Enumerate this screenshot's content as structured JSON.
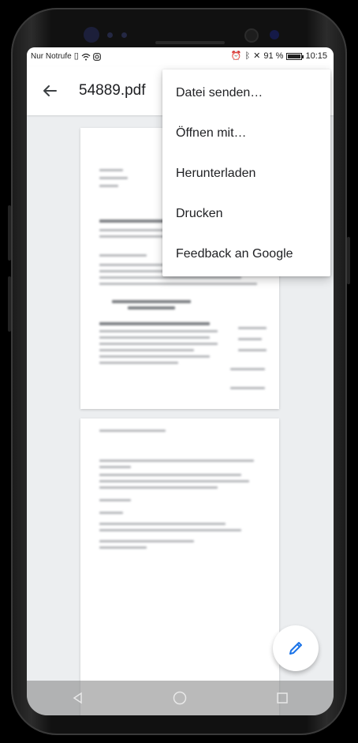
{
  "status_bar": {
    "carrier": "Nur Notrufe",
    "battery_percent": "91 %",
    "time": "10:15",
    "battery_level": 0.91
  },
  "app_bar": {
    "back_icon": "arrow-back-icon",
    "title": "54889.pdf"
  },
  "overflow_menu": {
    "items": [
      {
        "label": "Datei senden…"
      },
      {
        "label": "Öffnen mit…"
      },
      {
        "label": "Herunterladen"
      },
      {
        "label": "Drucken"
      },
      {
        "label": "Feedback an Google"
      }
    ]
  },
  "fab": {
    "icon": "edit-pencil-icon",
    "color": "#1a73e8"
  },
  "nav_bar": {
    "back_icon": "nav-back-triangle-icon",
    "home_icon": "nav-home-circle-icon",
    "recents_icon": "nav-recents-square-icon"
  },
  "colors": {
    "accent": "#1a73e8",
    "viewer_background": "#eceef0",
    "text_primary": "#202124"
  }
}
